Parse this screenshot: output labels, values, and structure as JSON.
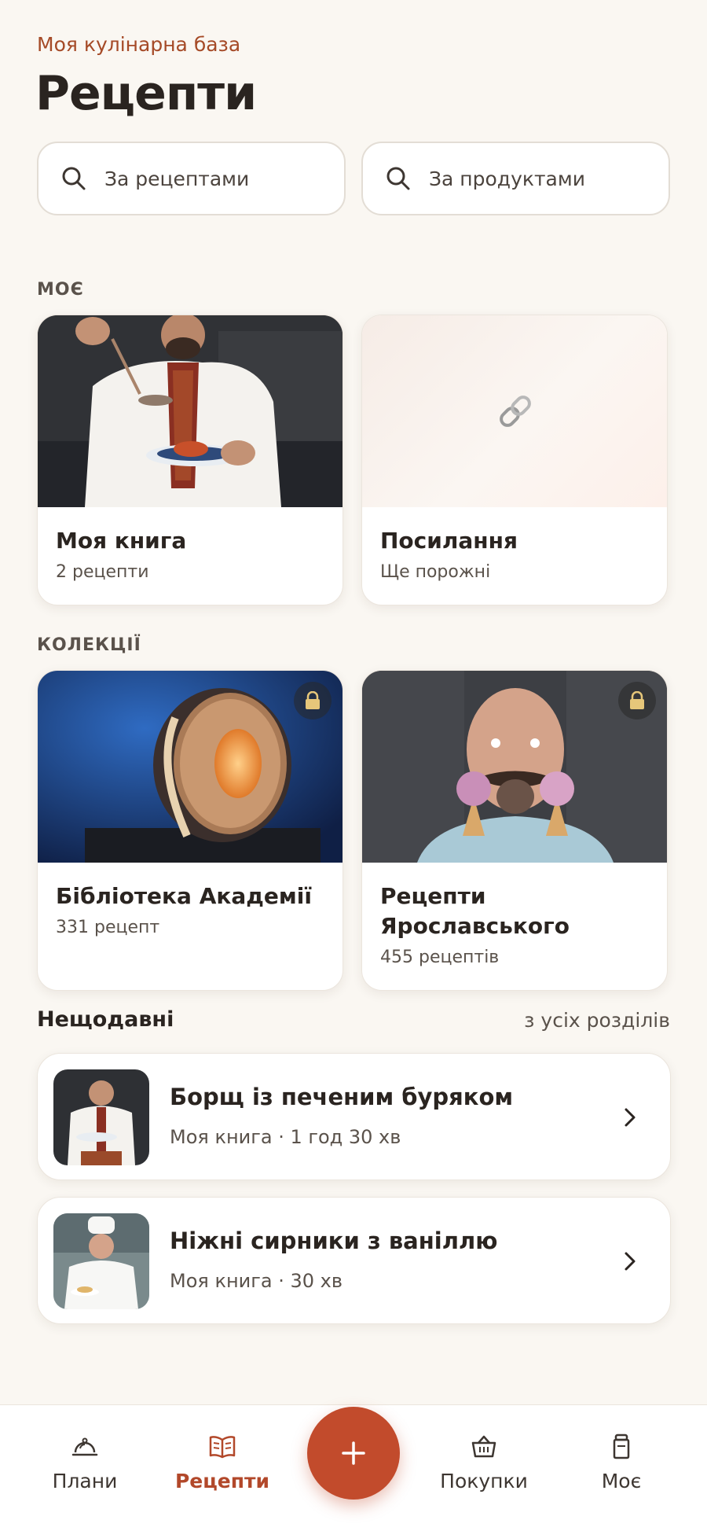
{
  "header": {
    "subtitle": "Моя кулінарна база",
    "title": "Рецепти"
  },
  "search": {
    "recipes": "За рецептами",
    "products": "За продуктами"
  },
  "sections": {
    "mine": "МОЄ",
    "collections": "КОЛЕКЦІЇ"
  },
  "mine": [
    {
      "name": "Моя книга",
      "meta": "2 рецепти"
    },
    {
      "name": "Посилання",
      "meta": "Ще порожні"
    }
  ],
  "collections": [
    {
      "name": "Бібліотека Академії",
      "meta": "331 рецепт",
      "locked": true
    },
    {
      "name": "Рецепти Ярославського",
      "meta": "455 рецептів",
      "locked": true
    }
  ],
  "recent": {
    "title": "Нещодавні",
    "more": "з усіх розділів",
    "items": [
      {
        "title": "Борщ із печеним буряком",
        "meta": "Моя книга · 1 год 30 хв"
      },
      {
        "title": "Ніжні сирники з ваніллю",
        "meta": "Моя книга · 30 хв"
      }
    ]
  },
  "tabs": [
    {
      "label": "Плани",
      "icon": "cloche-icon"
    },
    {
      "label": "Рецепти",
      "icon": "book-icon",
      "active": true
    },
    {
      "label": "Покупки",
      "icon": "basket-icon"
    },
    {
      "label": "Моє",
      "icon": "jar-icon"
    }
  ],
  "fab": {
    "icon": "plus-icon"
  },
  "colors": {
    "accent": "#c24b2c",
    "accent_text": "#a54a27",
    "background": "#faf7f2"
  }
}
